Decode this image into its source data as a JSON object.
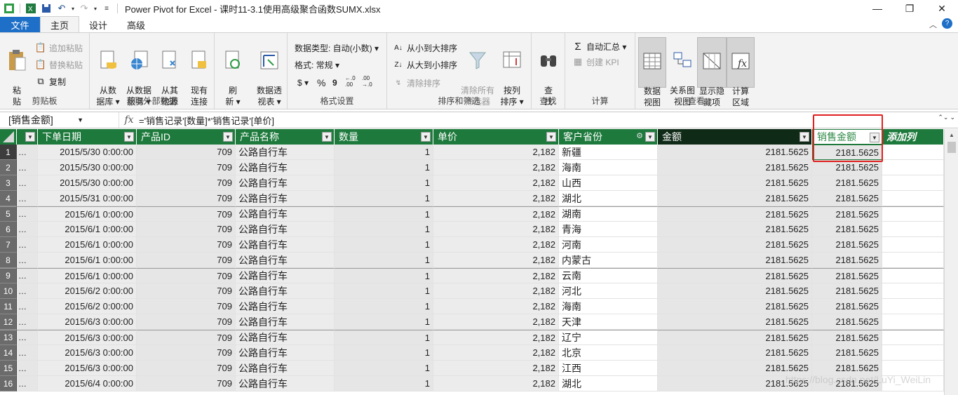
{
  "window": {
    "title": "Power Pivot for Excel - 课时11-3.1使用高级聚合函数SUMX.xlsx",
    "minimize": "—",
    "restore": "❐",
    "close": "✕"
  },
  "tabs": [
    {
      "label": "文件"
    },
    {
      "label": "主页"
    },
    {
      "label": "设计"
    },
    {
      "label": "高级"
    }
  ],
  "ribbon": {
    "clipboard": {
      "label": "剪贴板",
      "paste": "粘\n贴",
      "append_paste": "追加粘贴",
      "replace_paste": "替换粘贴",
      "copy": "复制"
    },
    "external": {
      "label": "获取外部数据",
      "from_db": "从数\n据库 ▾",
      "from_service": "从数据\n服务 ▾",
      "from_other": "从其\n他源",
      "existing": "现有\n连接"
    },
    "refresh": "刷\n新 ▾",
    "pivot": "数据透\n视表 ▾",
    "format": {
      "label": "格式设置",
      "data_type": "数据类型: 自动(小数) ▾",
      "format": "格式: 常规 ▾",
      "currency": "$ ▾",
      "percent": "%",
      "comma": "9",
      "inc_dec": "←.0\n.00",
      "dec_dec": ".00\n→.0"
    },
    "sort": {
      "label": "排序和筛选",
      "asc": "从小到大排序",
      "desc": "从大到小排序",
      "clear_sort": "清除排序",
      "clear_filters": "清除所有\n筛选器",
      "by_column": "按列\n排序 ▾"
    },
    "find": {
      "label": "查找",
      "find": "查\n找"
    },
    "calc": {
      "label": "计算",
      "autosum": "自动汇总 ▾",
      "kpi": "创建 KPI"
    },
    "view": {
      "label": "查看",
      "data_view": "数据\n视图",
      "diagram_view": "关系图\n视图",
      "show_hidden": "显示隐\n藏项",
      "calc_area": "计算\n区域"
    }
  },
  "formula_bar": {
    "name_box": "[销售金额]",
    "fx": "fx",
    "formula": "='销售记录'[数量]*'销售记录'[单价]"
  },
  "grid": {
    "columns": [
      "",
      "下单日期",
      "产品ID",
      "产品名称",
      "数量",
      "单价",
      "客户省份",
      "金额",
      "销售金额",
      "添加列"
    ],
    "rows": [
      {
        "n": "1",
        "a": "…",
        "date": "2015/5/30 0:00:00",
        "pid": "709",
        "name": "公路自行车",
        "qty": "1",
        "price": "2,182",
        "prov": "新疆",
        "amt": "2181.5625",
        "sales": "2181.5625"
      },
      {
        "n": "2",
        "a": "…",
        "date": "2015/5/30 0:00:00",
        "pid": "709",
        "name": "公路自行车",
        "qty": "1",
        "price": "2,182",
        "prov": "海南",
        "amt": "2181.5625",
        "sales": "2181.5625"
      },
      {
        "n": "3",
        "a": "…",
        "date": "2015/5/30 0:00:00",
        "pid": "709",
        "name": "公路自行车",
        "qty": "1",
        "price": "2,182",
        "prov": "山西",
        "amt": "2181.5625",
        "sales": "2181.5625"
      },
      {
        "n": "4",
        "a": "…",
        "date": "2015/5/31 0:00:00",
        "pid": "709",
        "name": "公路自行车",
        "qty": "1",
        "price": "2,182",
        "prov": "湖北",
        "amt": "2181.5625",
        "sales": "2181.5625"
      },
      {
        "n": "5",
        "a": "…",
        "date": "2015/6/1 0:00:00",
        "pid": "709",
        "name": "公路自行车",
        "qty": "1",
        "price": "2,182",
        "prov": "湖南",
        "amt": "2181.5625",
        "sales": "2181.5625"
      },
      {
        "n": "6",
        "a": "…",
        "date": "2015/6/1 0:00:00",
        "pid": "709",
        "name": "公路自行车",
        "qty": "1",
        "price": "2,182",
        "prov": "青海",
        "amt": "2181.5625",
        "sales": "2181.5625"
      },
      {
        "n": "7",
        "a": "…",
        "date": "2015/6/1 0:00:00",
        "pid": "709",
        "name": "公路自行车",
        "qty": "1",
        "price": "2,182",
        "prov": "河南",
        "amt": "2181.5625",
        "sales": "2181.5625"
      },
      {
        "n": "8",
        "a": "…",
        "date": "2015/6/1 0:00:00",
        "pid": "709",
        "name": "公路自行车",
        "qty": "1",
        "price": "2,182",
        "prov": "内蒙古",
        "amt": "2181.5625",
        "sales": "2181.5625"
      },
      {
        "n": "9",
        "a": "…",
        "date": "2015/6/1 0:00:00",
        "pid": "709",
        "name": "公路自行车",
        "qty": "1",
        "price": "2,182",
        "prov": "云南",
        "amt": "2181.5625",
        "sales": "2181.5625"
      },
      {
        "n": "10",
        "a": "…",
        "date": "2015/6/2 0:00:00",
        "pid": "709",
        "name": "公路自行车",
        "qty": "1",
        "price": "2,182",
        "prov": "河北",
        "amt": "2181.5625",
        "sales": "2181.5625"
      },
      {
        "n": "11",
        "a": "…",
        "date": "2015/6/2 0:00:00",
        "pid": "709",
        "name": "公路自行车",
        "qty": "1",
        "price": "2,182",
        "prov": "海南",
        "amt": "2181.5625",
        "sales": "2181.5625"
      },
      {
        "n": "12",
        "a": "…",
        "date": "2015/6/3 0:00:00",
        "pid": "709",
        "name": "公路自行车",
        "qty": "1",
        "price": "2,182",
        "prov": "天津",
        "amt": "2181.5625",
        "sales": "2181.5625"
      },
      {
        "n": "13",
        "a": "…",
        "date": "2015/6/3 0:00:00",
        "pid": "709",
        "name": "公路自行车",
        "qty": "1",
        "price": "2,182",
        "prov": "辽宁",
        "amt": "2181.5625",
        "sales": "2181.5625"
      },
      {
        "n": "14",
        "a": "…",
        "date": "2015/6/3 0:00:00",
        "pid": "709",
        "name": "公路自行车",
        "qty": "1",
        "price": "2,182",
        "prov": "北京",
        "amt": "2181.5625",
        "sales": "2181.5625"
      },
      {
        "n": "15",
        "a": "…",
        "date": "2015/6/3 0:00:00",
        "pid": "709",
        "name": "公路自行车",
        "qty": "1",
        "price": "2,182",
        "prov": "江西",
        "amt": "2181.5625",
        "sales": "2181.5625"
      },
      {
        "n": "16",
        "a": "…",
        "date": "2015/6/4 0:00:00",
        "pid": "709",
        "name": "公路自行车",
        "qty": "1",
        "price": "2,182",
        "prov": "湖北",
        "amt": "2181.5625",
        "sales": "2181.5625"
      }
    ]
  },
  "watermark": "https://blog.csdn.net/LuYi_WeiLin",
  "colors": {
    "header_green": "#1d7a3c",
    "file_tab_blue": "#1e6fc7",
    "highlight_red": "#e02020"
  }
}
